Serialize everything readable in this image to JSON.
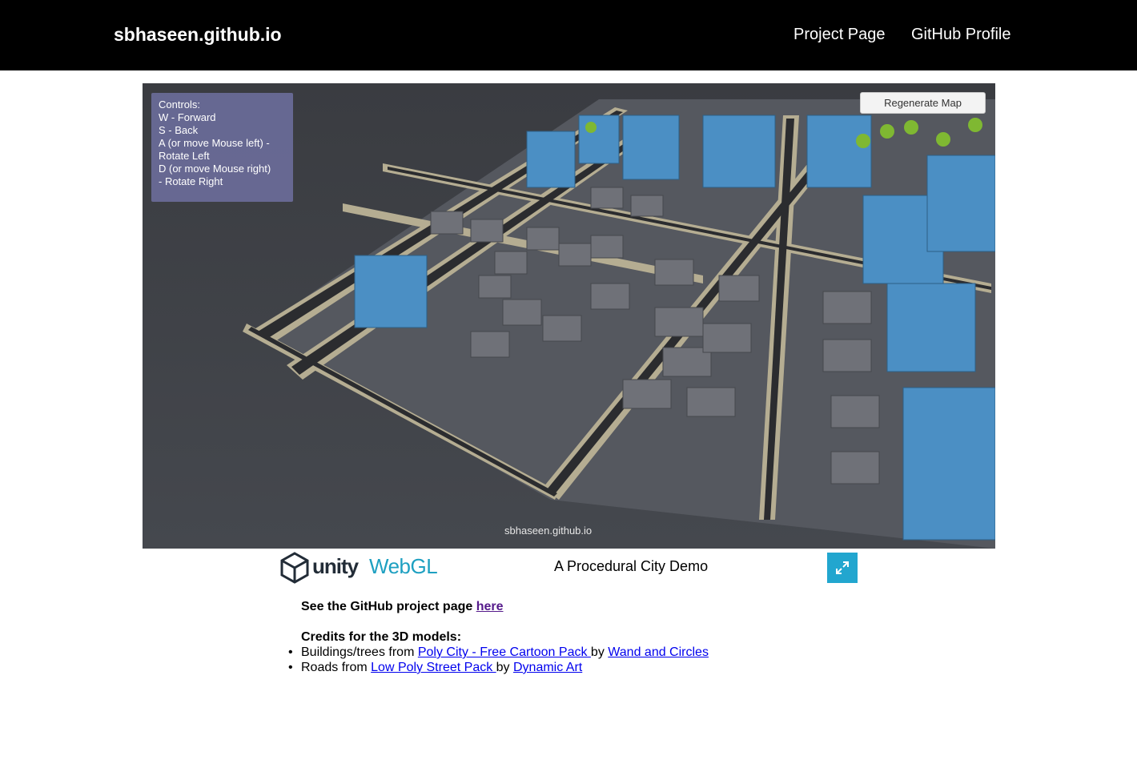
{
  "navbar": {
    "brand": "sbhaseen.github.io",
    "links": [
      "Project Page",
      "GitHub Profile"
    ]
  },
  "game": {
    "controls": {
      "lines": [
        "Controls:",
        "W - Forward",
        "S - Back",
        "A (or move Mouse left) -",
        "Rotate Left",
        "D (or move Mouse right)",
        "- Rotate Right"
      ]
    },
    "regenerate_label": "Regenerate Map",
    "watermark": "sbhaseen.github.io"
  },
  "footer": {
    "unity_word": "unity",
    "webgl_word": "WebGL",
    "title": "A Procedural City Demo"
  },
  "content": {
    "github_prefix": "See the GitHub project page ",
    "github_link": "here",
    "credits_heading": "Credits for the 3D models:",
    "credits": [
      {
        "prefix": "Buildings/trees from ",
        "link": "Poly City - Free Cartoon Pack ",
        "by": "by ",
        "author": "Wand and Circles"
      },
      {
        "prefix": "Roads from ",
        "link": "Low Poly Street Pack ",
        "by": "by ",
        "author": "Dynamic Art"
      }
    ]
  },
  "colors": {
    "navbar_bg": "#000000",
    "link": "#0000ee",
    "visited_link": "#551a8b",
    "webgl_accent": "#1ea0c1",
    "fullscreen_btn": "#22a6cf",
    "controls_panel": "#6e70a0"
  }
}
